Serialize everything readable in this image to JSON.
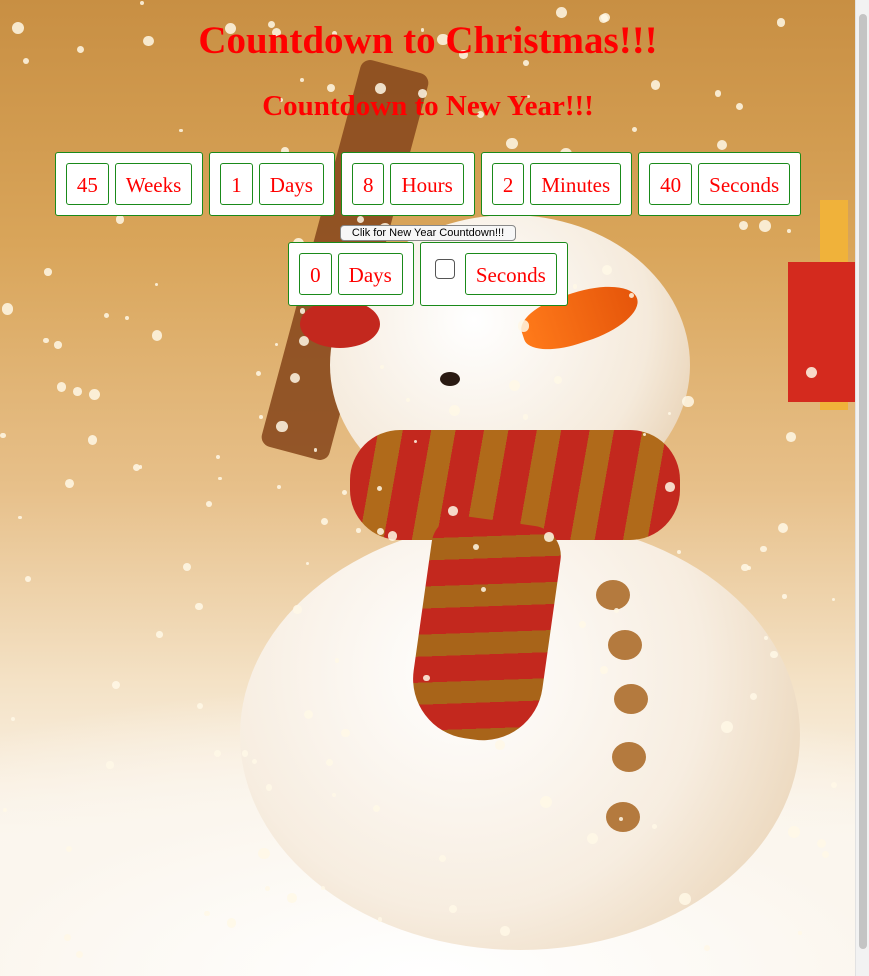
{
  "page": {
    "title": "Countdown to Christmas!!!",
    "subtitle": "Countdown to New Year!!!"
  },
  "christmas_countdown": [
    {
      "value": "45",
      "unit": "Weeks"
    },
    {
      "value": "1",
      "unit": "Days"
    },
    {
      "value": "8",
      "unit": "Hours"
    },
    {
      "value": "2",
      "unit": "Minutes"
    },
    {
      "value": "40",
      "unit": "Seconds"
    }
  ],
  "toggle_button": {
    "label": "Clik for New Year Countdown!!!"
  },
  "new_year_countdown": {
    "days": {
      "value": "0",
      "unit": "Days"
    },
    "seconds": {
      "checked": false,
      "unit": "Seconds"
    }
  },
  "colors": {
    "text": "#ff0000",
    "border": "#1a8a1a"
  }
}
